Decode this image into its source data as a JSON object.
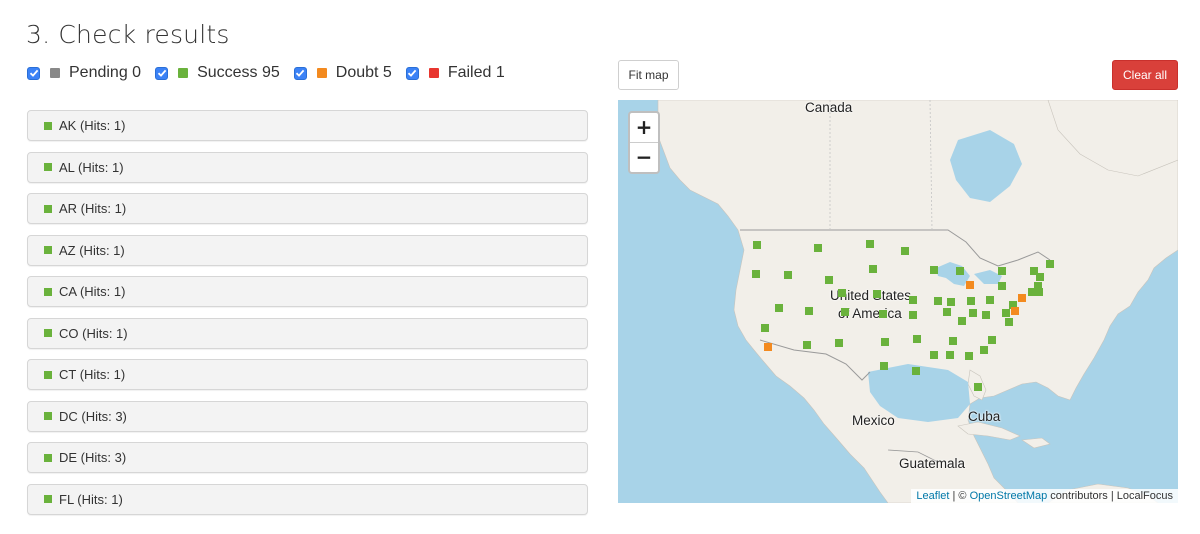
{
  "heading": "3. Check results",
  "filters": [
    {
      "label": "Pending 0",
      "color": "#888888",
      "checked": true
    },
    {
      "label": "Success 95",
      "color": "#6ab23c",
      "checked": true
    },
    {
      "label": "Doubt 5",
      "color": "#f38a1f",
      "checked": true
    },
    {
      "label": "Failed 1",
      "color": "#e8362f",
      "checked": true
    }
  ],
  "results": [
    {
      "label": "AK (Hits: 1)"
    },
    {
      "label": "AL (Hits: 1)"
    },
    {
      "label": "AR (Hits: 1)"
    },
    {
      "label": "AZ (Hits: 1)"
    },
    {
      "label": "CA (Hits: 1)"
    },
    {
      "label": "CO (Hits: 1)"
    },
    {
      "label": "CT (Hits: 1)"
    },
    {
      "label": "DC (Hits: 3)"
    },
    {
      "label": "DE (Hits: 3)"
    },
    {
      "label": "FL (Hits: 1)"
    }
  ],
  "result_color": "#6ab23c",
  "buttons": {
    "fit_map": "Fit map",
    "clear_all": "Clear all"
  },
  "map": {
    "zoom_in": "+",
    "zoom_out": "−",
    "labels": {
      "canada": "Canada",
      "usa_line1": "United States",
      "usa_line2": "of America",
      "mexico": "Mexico",
      "cuba": "Cuba",
      "guatemala": "Guatemala"
    },
    "attribution": {
      "leaflet": "Leaflet",
      "sep1": " | © ",
      "osm": "OpenStreetMap",
      "rest": " contributors | LocalFocus"
    },
    "colors": {
      "water": "#a8d3e8",
      "land": "#f2efe9",
      "success": "#6ab23c",
      "doubt": "#f38a1f"
    }
  }
}
